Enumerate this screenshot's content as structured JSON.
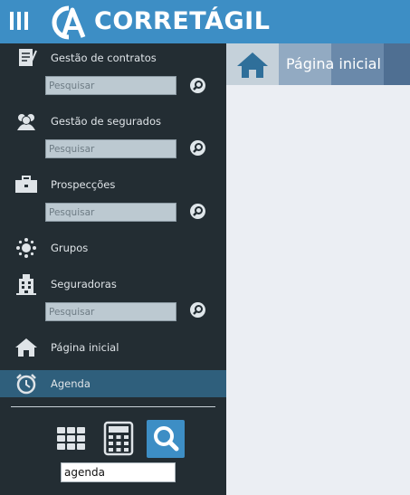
{
  "app": {
    "brand": "CORRETÁGIL",
    "brand_monogram": "CA"
  },
  "colors": {
    "brand_blue": "#3d8ec5",
    "sidebar_bg": "#232d33",
    "active_item_bg": "#2f5f7c",
    "content_bg": "#ebeef3"
  },
  "sidebar": {
    "items": [
      {
        "label": "Gestão de contratos",
        "icon": "contracts-icon",
        "search_placeholder": "Pesquisar"
      },
      {
        "label": "Gestão de segurados",
        "icon": "insured-people-icon",
        "search_placeholder": "Pesquisar"
      },
      {
        "label": "Prospecções",
        "icon": "briefcase-icon",
        "search_placeholder": "Pesquisar"
      },
      {
        "label": "Grupos",
        "icon": "groups-icon"
      },
      {
        "label": "Seguradoras",
        "icon": "building-icon",
        "search_placeholder": "Pesquisar"
      },
      {
        "label": "Página inicial",
        "icon": "home-icon"
      },
      {
        "label": "Agenda",
        "icon": "alarm-clock-icon",
        "active": true
      }
    ],
    "tools": [
      "apps-grid-icon",
      "calculator-icon",
      "search-icon"
    ],
    "tool_input_value": "agenda"
  },
  "main": {
    "tab_icon": "home-icon",
    "page_title": "Página inicial"
  }
}
